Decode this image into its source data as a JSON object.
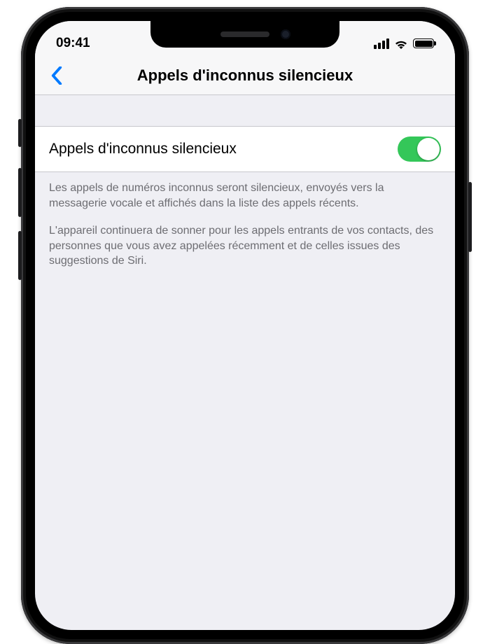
{
  "status": {
    "time": "09:41"
  },
  "nav": {
    "title": "Appels d'inconnus silencieux"
  },
  "setting": {
    "label": "Appels d'inconnus silencieux",
    "enabled": true
  },
  "footer": {
    "p1": "Les appels de numéros inconnus seront silencieux, envoyés vers la messagerie vocale et affichés dans la liste des appels récents.",
    "p2": "L'appareil continuera de sonner pour les appels entrants de vos contacts, des personnes que vous avez appelées récemment et de celles issues des suggestions de Siri."
  },
  "colors": {
    "tint": "#007aff",
    "toggleOn": "#34c759"
  }
}
